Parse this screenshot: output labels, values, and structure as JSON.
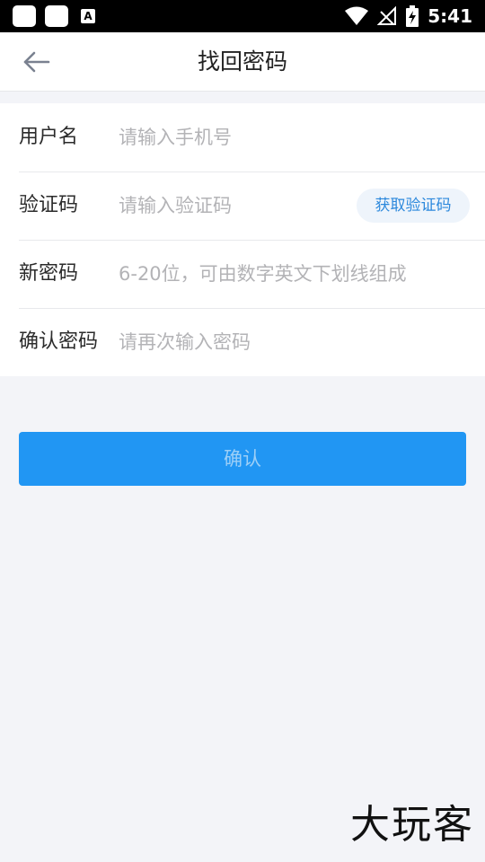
{
  "status_bar": {
    "time": "5:41",
    "a_label": "A",
    "icons": [
      "app-square-icon",
      "app-square-icon",
      "a-notification-icon",
      "wifi-icon",
      "no-signal-icon",
      "battery-charging-icon"
    ]
  },
  "nav": {
    "title": "找回密码",
    "back_icon": "back-arrow-icon"
  },
  "form": {
    "username": {
      "label": "用户名",
      "placeholder": "请输入手机号",
      "value": ""
    },
    "code": {
      "label": "验证码",
      "placeholder": "请输入验证码",
      "value": "",
      "button": "获取验证码"
    },
    "new_password": {
      "label": "新密码",
      "placeholder": "6-20位，可由数字英文下划线组成",
      "value": ""
    },
    "confirm_password": {
      "label": "确认密码",
      "placeholder": "请再次输入密码",
      "value": ""
    }
  },
  "confirm_button": "确认",
  "watermark": "大玩客",
  "colors": {
    "accent": "#2196f3",
    "background": "#f3f4f8",
    "code_button_text": "#2c88dc"
  }
}
